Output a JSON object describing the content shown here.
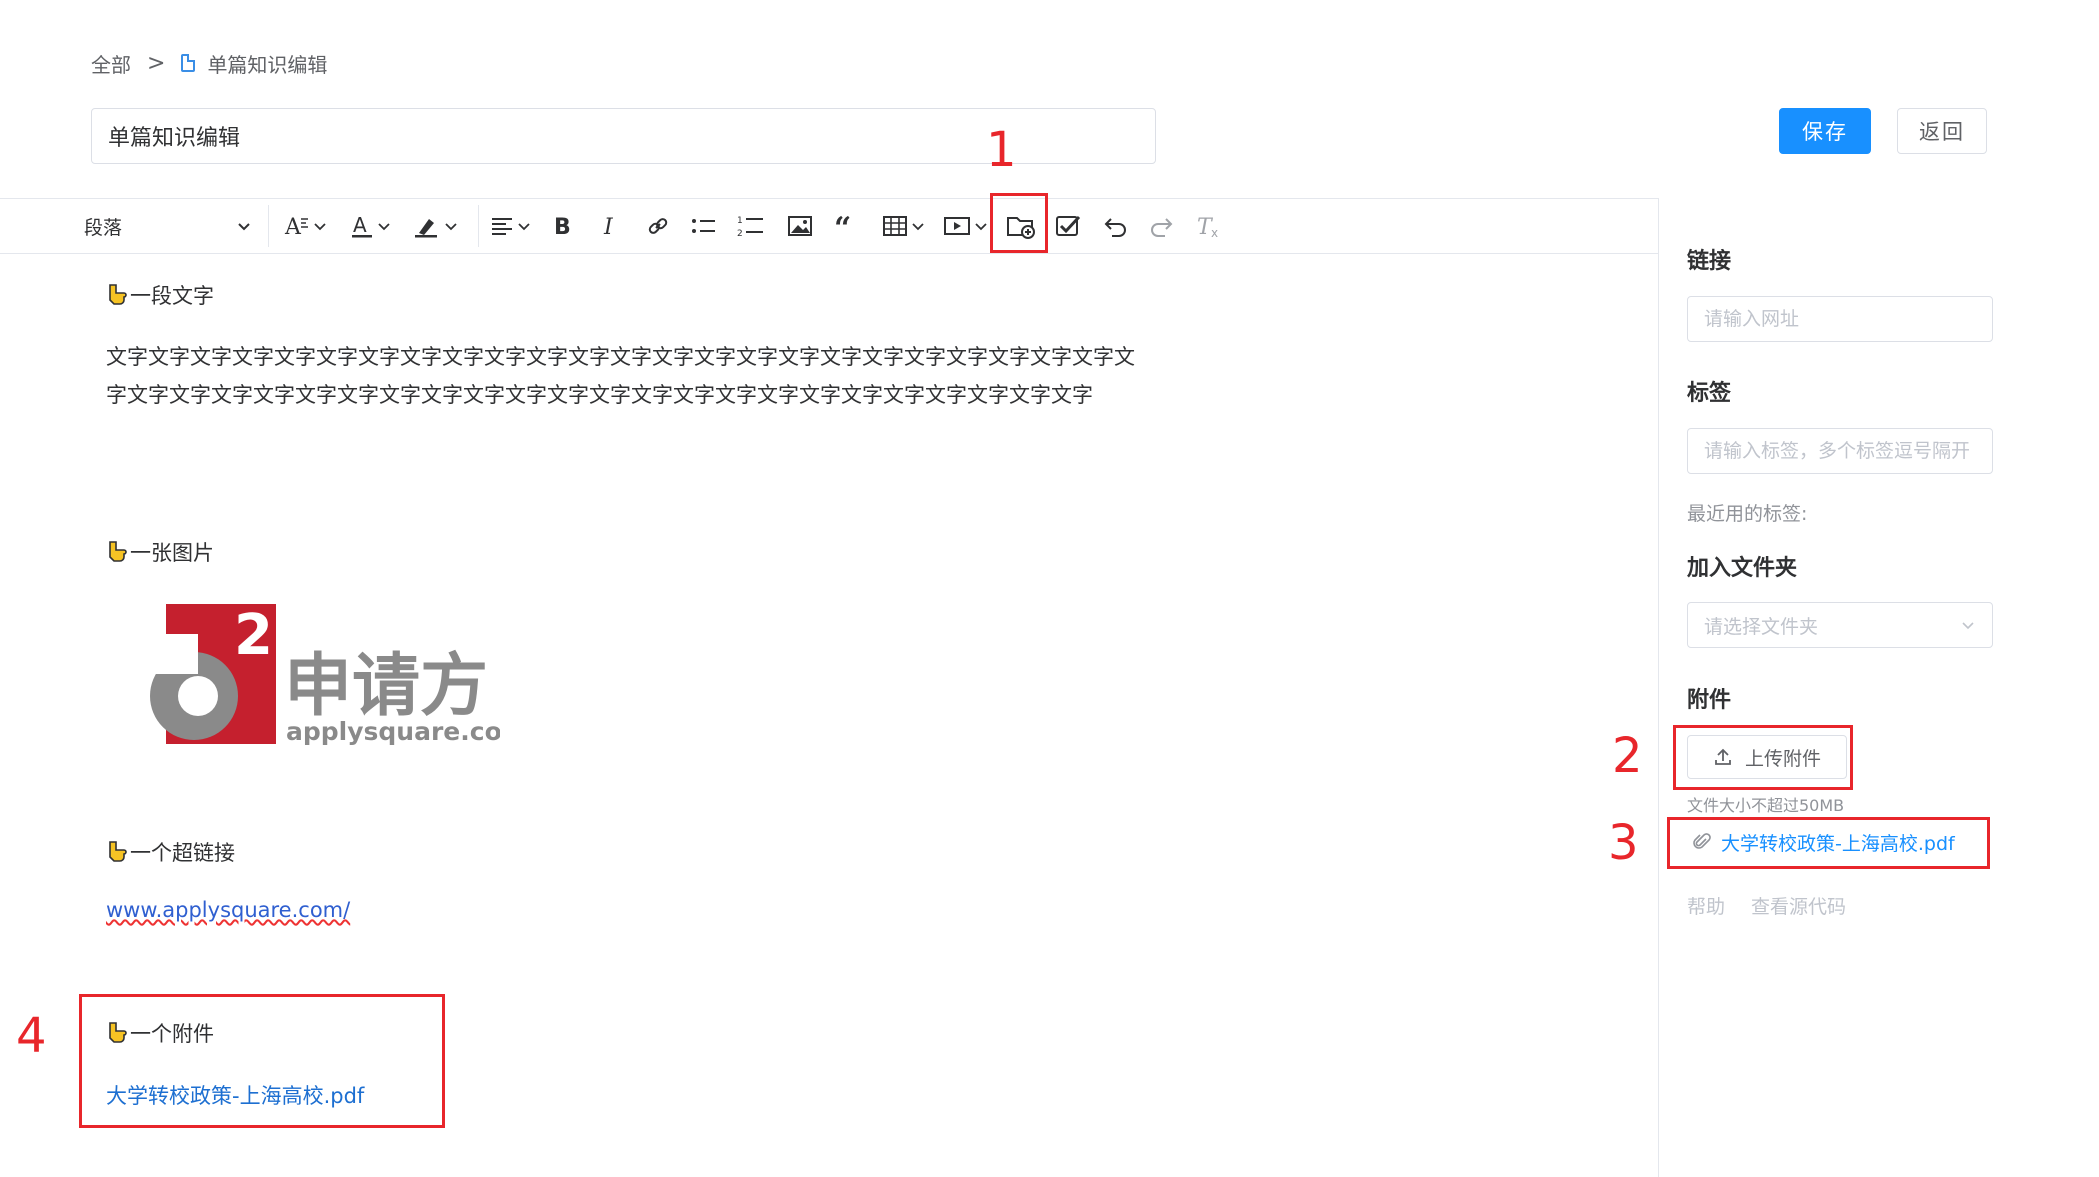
{
  "breadcrumb": {
    "root": "全部",
    "separator": ">",
    "current": "单篇知识编辑"
  },
  "title": {
    "value": "单篇知识编辑"
  },
  "actions": {
    "save": "保存",
    "back": "返回"
  },
  "toolbar": {
    "block_format": "段落",
    "icons": [
      "font-size-icon",
      "font-color-icon",
      "highlight-icon",
      "align-icon",
      "bold-icon",
      "italic-icon",
      "link-icon",
      "bullet-list-icon",
      "numbered-list-icon",
      "image-icon",
      "quote-icon",
      "table-icon",
      "media-icon",
      "attachment-folder-icon",
      "todo-icon",
      "undo-icon",
      "redo-icon",
      "clear-format-icon"
    ]
  },
  "sidebar": {
    "link_label": "链接",
    "link_placeholder": "请输入网址",
    "tags_label": "标签",
    "tags_placeholder": "请输入标签，多个标签逗号隔开",
    "recent_tags": "最近用的标签:",
    "folder_label": "加入文件夹",
    "folder_placeholder": "请选择文件夹",
    "attachments_label": "附件",
    "upload_button": "上传附件",
    "upload_tip": "文件大小不超过50MB",
    "attachment_file": "大学转校政策-上海高校.pdf",
    "help": "帮助",
    "view_source": "查看源代码"
  },
  "content": {
    "h1": "一段文字",
    "paragraph": "文字文字文字文字文字文字文字文字文字文字文字文字文字文字文字文字文字文字文字文字文字文字文字文字文字文字文字文字文字文字文字文字文字文字文字文字文字文字文字文字文字文字文字文字文字文字文字文字",
    "h2": "一张图片",
    "logo": {
      "brand_cn": "申请方",
      "brand_url": "applysquare.com",
      "badge": "a",
      "sup": "2"
    },
    "h3": "一个超链接",
    "link": "www.applysquare.com/",
    "h4": "一个附件",
    "attachment": "大学转校政策-上海高校.pdf"
  },
  "annotations": {
    "n1": "1",
    "n2": "2",
    "n3": "3",
    "n4": "4"
  },
  "colors": {
    "primary": "#1890ff",
    "annotation": "#e8262b",
    "logo_red": "#c5202e",
    "logo_gray": "#8a8a8a"
  }
}
